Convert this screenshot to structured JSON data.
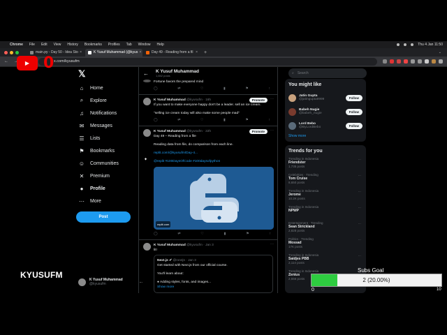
{
  "menubar": {
    "apple": "",
    "items": [
      "Chrome",
      "File",
      "Edit",
      "View",
      "History",
      "Bookmarks",
      "Profiles",
      "Tab",
      "Window",
      "Help"
    ],
    "clock": "Thu 4 Jan  11:50"
  },
  "tabs": [
    {
      "label": "main.py - Day 50 - Idea Sto",
      "active": false
    },
    {
      "label": "K Yusuf Muhammad (@kyus",
      "active": true
    },
    {
      "label": "Day 49 - Reading from a fil",
      "active": false
    }
  ],
  "toolbar": {
    "url": "x.com/kyusufm"
  },
  "overlay": {
    "yt_label": "▶",
    "zero_text": "0"
  },
  "twitter": {
    "nav": [
      {
        "label": "Home",
        "icon": "home-icon",
        "glyph": "⌂"
      },
      {
        "label": "Explore",
        "icon": "search-icon",
        "glyph": "⌕"
      },
      {
        "label": "Notifications",
        "icon": "bell-icon",
        "glyph": "♫"
      },
      {
        "label": "Messages",
        "icon": "mail-icon",
        "glyph": "✉"
      },
      {
        "label": "Lists",
        "icon": "list-icon",
        "glyph": "☰"
      },
      {
        "label": "Bookmarks",
        "icon": "bookmark-icon",
        "glyph": "⚑"
      },
      {
        "label": "Communities",
        "icon": "people-icon",
        "glyph": "☺"
      },
      {
        "label": "Premium",
        "icon": "x-icon",
        "glyph": "✕"
      },
      {
        "label": "Profile",
        "icon": "person-icon",
        "glyph": "●"
      },
      {
        "label": "More",
        "icon": "more-icon",
        "glyph": "⋯"
      }
    ],
    "post_label": "Post",
    "account": {
      "name": "K Yusuf Muhammad",
      "handle": "@kyusufm",
      "more": "..."
    },
    "profile_header": {
      "name": "K Yusuf Muhammad",
      "count": "1,652 posts"
    },
    "tweets": [
      {
        "text": "Fortune favors the prepared mind",
        "partial": true
      },
      {
        "name": "K Yusuf Muhammad",
        "handle": "@kyusufm · 16h",
        "promote": "Promote",
        "lines": [
          "If you want to make everyone happy don't be a leader. sell an ice cream.",
          "",
          "\"selling ice cream today will also make some people mad\""
        ]
      },
      {
        "name": "K Yusuf Muhammad",
        "handle": "@kyusufm · 22h",
        "promote": "Promote",
        "lines": [
          "Day 49 – Reading from a file",
          "",
          "Reading data from file, do comparison from each line."
        ],
        "link": "replit.com/@kyusufm/Day-4...",
        "tags": "@replit #100DaysOfCode #100daysofpython",
        "card_domain": "replit.com"
      },
      {
        "name": "K Yusuf Muhammad",
        "handle": "@kyusufm · Jan 3",
        "lines": [
          "lit!"
        ],
        "quote": {
          "name": "Next.js ✔",
          "handle": "@nextjs · Jan 3",
          "lines": [
            "Get started with Next.js from our official course.",
            "",
            "You'll learn about:",
            "",
            "● Adding styles, fonts, and images..."
          ],
          "showmore": "Show more"
        }
      }
    ],
    "search_placeholder": "Search",
    "you_might_like": {
      "title": "You might like",
      "people": [
        {
          "name": "Jatin Gupta",
          "handle": "@jatingupta9999",
          "button": "Follow"
        },
        {
          "name": "Babeh Nugie",
          "handle": "@babeh_nugie",
          "button": "Follow"
        },
        {
          "name": "Lord Bebo",
          "handle": "@ByLordBebo",
          "button": "Follow"
        }
      ],
      "show_more": "Show more"
    },
    "trends": {
      "title": "Trends for you",
      "items": [
        {
          "ctx": "Trending in Indonesia",
          "topic": "Friendster",
          "posts": "1,735 posts"
        },
        {
          "ctx": "Celebrities · Trending",
          "topic": "Tom Cruise",
          "posts": "8,650 posts"
        },
        {
          "ctx": "Trending in Indonesia",
          "topic": "Jerome",
          "posts": "10.2K posts"
        },
        {
          "ctx": "Trending in Indonesia",
          "topic": "NPWP",
          "posts": ""
        },
        {
          "ctx": "Entertainment · Trending",
          "topic": "Sean Strickland",
          "posts": "2,828 posts"
        },
        {
          "ctx": "Politics · Trending",
          "topic": "Mossad",
          "posts": "17K posts"
        },
        {
          "ctx": "Trending in Indonesia",
          "topic": "Saidjes PBB",
          "posts": "2,114 posts"
        },
        {
          "ctx": "Trending in Indonesia",
          "topic": "Zenius",
          "posts": "2,556 posts"
        }
      ]
    }
  },
  "brand": "KYUSUFM",
  "subs_goal": {
    "title": "Subs Goal",
    "value": 2,
    "goal": 10,
    "text": "2 (20.00%)",
    "min": "0",
    "max": "10",
    "fraction": 0.2,
    "bg_partial": "Bo$$Rights"
  },
  "colors": {
    "accent": "#1d9bf0",
    "goal_fill": "#2ecc40",
    "yt_red": "#ee0000"
  }
}
